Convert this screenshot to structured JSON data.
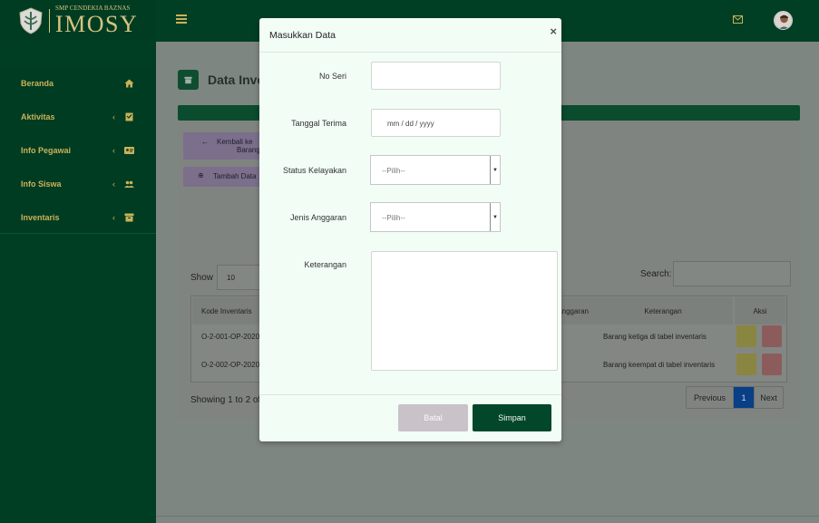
{
  "brand": {
    "school": "SMP CENDEKIA BAZNAS",
    "app": "IMOSY"
  },
  "sidebar": {
    "items": [
      {
        "label": "Beranda",
        "icon": "home-icon",
        "chevron": ""
      },
      {
        "label": "Aktivitas",
        "icon": "bookmark-icon",
        "chevron": "‹"
      },
      {
        "label": "Info Pegawai",
        "icon": "id-card-icon",
        "chevron": "‹"
      },
      {
        "label": "Info Siswa",
        "icon": "users-icon",
        "chevron": "‹"
      },
      {
        "label": "Inventaris",
        "icon": "archive-icon",
        "chevron": "‹"
      }
    ]
  },
  "page": {
    "title": "Data Inventaris",
    "back_button": "Kembali ke Daftar Barang",
    "back_line1": "Kembali ke",
    "back_line2": "Barang",
    "add_button": "Tambah Data",
    "show_label": "Show",
    "show_value": "10",
    "search_label": "Search:",
    "showing": "Showing 1 to 2 of 2 entries",
    "pager": {
      "prev": "Previous",
      "current": "1",
      "next": "Next"
    }
  },
  "table": {
    "headers": [
      "Kode Inventaris",
      "Anggaran",
      "Keterangan",
      "Aksi"
    ],
    "rows": [
      {
        "kode": "O-2-001-OP-2020",
        "keterangan": "Barang ketiga di tabel inventaris"
      },
      {
        "kode": "O-2-002-OP-2020",
        "keterangan": "Barang keempat di tabel inventaris"
      }
    ]
  },
  "modal": {
    "title": "Masukkan Data",
    "close": "×",
    "fields": {
      "no_seri": {
        "label": "No Seri",
        "value": ""
      },
      "tanggal": {
        "label": "Tanggal Terima",
        "placeholder": "mm / dd / yyyy"
      },
      "status": {
        "label": "Status Kelayakan",
        "value": "--Pilih--"
      },
      "jenis": {
        "label": "Jenis Anggaran",
        "value": "--Pilih--"
      },
      "keterangan": {
        "label": "Keterangan",
        "value": ""
      }
    },
    "cancel": "Batal",
    "save": "Simpan"
  },
  "colors": {
    "primary_green": "#03472a",
    "sidebar_gold": "#c9b25a",
    "modal_bg": "#f2fdf6",
    "cancel_bg": "#c9c2c8",
    "pager_active": "#083f87"
  }
}
